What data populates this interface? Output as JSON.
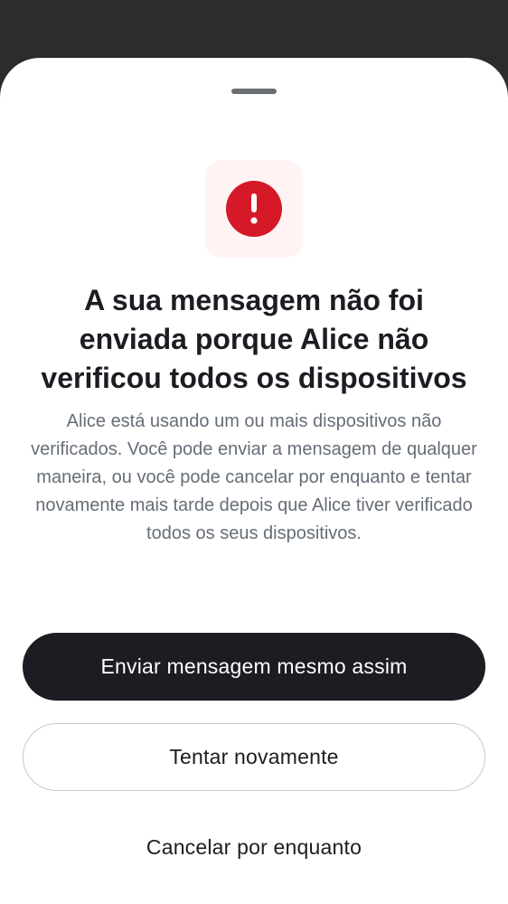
{
  "dialog": {
    "title": "A sua mensagem não foi enviada porque Alice não verificou todos os dispositivos",
    "body": "Alice está usando um ou mais dispositivos não verificados. Você pode enviar a mensagem de qualquer maneira, ou você pode cancelar por enquanto e tentar novamente mais tarde depois que Alice tiver verificado todos os seus dispositivos.",
    "icon": "error-alert-icon",
    "icon_color": "#d51928",
    "actions": {
      "send_anyway_label": "Enviar mensagem mesmo assim",
      "retry_label": "Tentar novamente",
      "cancel_label": "Cancelar por enquanto"
    }
  },
  "colors": {
    "backdrop": "#2b2c2e",
    "primary_button": "#1b1d22",
    "body_text": "#656d77",
    "icon_tile": "#fff4f3"
  }
}
